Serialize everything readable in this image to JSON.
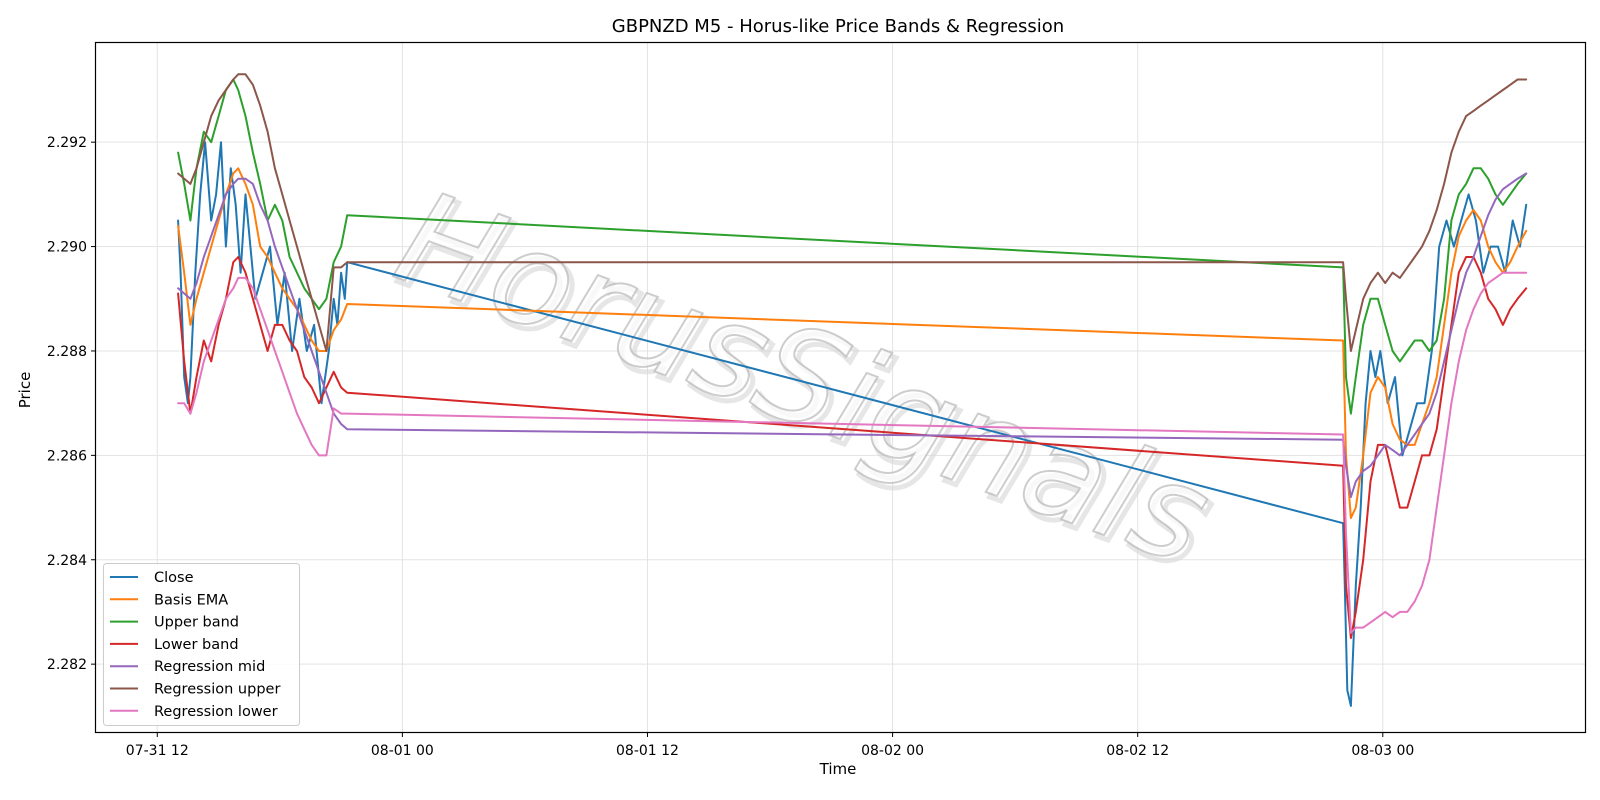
{
  "chart_data": {
    "type": "line",
    "title": "GBPNZD M5 - Horus-like Price Bands & Regression",
    "xlabel": "Time",
    "ylabel": "Price",
    "watermark": "HorusSignals",
    "ylim": [
      2.2807,
      2.2939
    ],
    "xlim": [
      -2.5,
      58.25
    ],
    "grid": true,
    "legend_position": "lower-left",
    "x_ticks": [
      {
        "value": 0,
        "label": "07-31 12"
      },
      {
        "value": 10,
        "label": "08-01 00"
      },
      {
        "value": 20,
        "label": "08-01 12"
      },
      {
        "value": 30,
        "label": "08-02 00"
      },
      {
        "value": 40,
        "label": "08-02 12"
      },
      {
        "value": 50,
        "label": "08-03 00"
      }
    ],
    "y_ticks": [
      {
        "value": 2.282,
        "label": "2.282"
      },
      {
        "value": 2.284,
        "label": "2.284"
      },
      {
        "value": 2.286,
        "label": "2.286"
      },
      {
        "value": 2.288,
        "label": "2.288"
      },
      {
        "value": 2.29,
        "label": "2.290"
      },
      {
        "value": 2.292,
        "label": "2.292"
      }
    ],
    "series": [
      {
        "name": "Close",
        "color": "#1f77b4",
        "x": [
          0.85,
          0.95,
          1.1,
          1.25,
          1.35,
          1.55,
          1.75,
          1.95,
          2.2,
          2.4,
          2.6,
          2.8,
          3.0,
          3.2,
          3.4,
          3.6,
          3.8,
          4.0,
          4.3,
          4.6,
          4.9,
          5.2,
          5.5,
          5.8,
          6.1,
          6.4,
          6.7,
          7.0,
          7.2,
          7.35,
          7.5,
          7.65,
          7.75,
          48.38,
          48.45,
          48.55,
          48.7,
          48.9,
          49.1,
          49.3,
          49.5,
          49.7,
          49.9,
          50.2,
          50.5,
          50.8,
          51.1,
          51.4,
          51.7,
          52.0,
          52.3,
          52.6,
          52.9,
          53.2,
          53.5,
          53.8,
          54.1,
          54.4,
          54.7,
          55.0,
          55.3,
          55.6,
          55.85
        ],
        "y": [
          2.2905,
          2.2895,
          2.2875,
          2.287,
          2.2875,
          2.2895,
          2.291,
          2.292,
          2.2905,
          2.291,
          2.292,
          2.29,
          2.2915,
          2.2908,
          2.2895,
          2.291,
          2.29,
          2.289,
          2.2895,
          2.29,
          2.2885,
          2.2895,
          2.288,
          2.289,
          2.288,
          2.2885,
          2.287,
          2.288,
          2.289,
          2.2885,
          2.2895,
          2.289,
          2.2897,
          2.2847,
          2.2835,
          2.2815,
          2.2812,
          2.2835,
          2.285,
          2.287,
          2.288,
          2.2875,
          2.288,
          2.287,
          2.2875,
          2.286,
          2.2865,
          2.287,
          2.287,
          2.288,
          2.29,
          2.2905,
          2.29,
          2.2905,
          2.291,
          2.2905,
          2.2895,
          2.29,
          2.29,
          2.2895,
          2.2905,
          2.29,
          2.2908
        ]
      },
      {
        "name": "Basis EMA",
        "color": "#ff7f0e",
        "x": [
          0.85,
          1.1,
          1.35,
          1.6,
          1.9,
          2.2,
          2.5,
          2.8,
          3.1,
          3.3,
          3.6,
          3.9,
          4.2,
          4.5,
          4.8,
          5.1,
          5.4,
          5.7,
          6.0,
          6.3,
          6.6,
          6.9,
          7.2,
          7.5,
          7.75,
          48.38,
          48.5,
          48.7,
          48.9,
          49.2,
          49.5,
          49.8,
          50.1,
          50.4,
          50.7,
          51.0,
          51.3,
          51.6,
          51.9,
          52.2,
          52.5,
          52.8,
          53.1,
          53.4,
          53.7,
          54.0,
          54.3,
          54.6,
          54.9,
          55.2,
          55.5,
          55.85
        ],
        "y": [
          2.2904,
          2.2895,
          2.2885,
          2.289,
          2.2895,
          2.29,
          2.2905,
          2.291,
          2.2914,
          2.2915,
          2.2912,
          2.2908,
          2.29,
          2.2898,
          2.2895,
          2.2892,
          2.289,
          2.2888,
          2.2885,
          2.2882,
          2.288,
          2.288,
          2.2884,
          2.2886,
          2.2889,
          2.2882,
          2.286,
          2.2848,
          2.285,
          2.286,
          2.2872,
          2.2875,
          2.2873,
          2.2866,
          2.2863,
          2.2862,
          2.2862,
          2.2866,
          2.287,
          2.2875,
          2.2885,
          2.2895,
          2.2902,
          2.2905,
          2.2907,
          2.2905,
          2.29,
          2.2897,
          2.2895,
          2.2897,
          2.29,
          2.2903
        ]
      },
      {
        "name": "Upper band",
        "color": "#2ca02c",
        "x": [
          0.85,
          1.1,
          1.35,
          1.6,
          1.9,
          2.2,
          2.5,
          2.8,
          3.1,
          3.3,
          3.6,
          3.9,
          4.2,
          4.5,
          4.8,
          5.1,
          5.4,
          5.7,
          6.0,
          6.3,
          6.6,
          6.9,
          7.2,
          7.5,
          7.75,
          48.38,
          48.5,
          48.7,
          48.9,
          49.2,
          49.5,
          49.8,
          50.1,
          50.4,
          50.7,
          51.0,
          51.3,
          51.6,
          51.9,
          52.2,
          52.5,
          52.8,
          53.1,
          53.4,
          53.7,
          54.0,
          54.3,
          54.6,
          54.9,
          55.2,
          55.5,
          55.85
        ],
        "y": [
          2.2918,
          2.2912,
          2.2905,
          2.2915,
          2.2922,
          2.292,
          2.2925,
          2.293,
          2.2932,
          2.293,
          2.2925,
          2.2918,
          2.2912,
          2.2905,
          2.2908,
          2.2905,
          2.2898,
          2.2895,
          2.2892,
          2.289,
          2.2888,
          2.289,
          2.2897,
          2.29,
          2.2906,
          2.2896,
          2.2875,
          2.2868,
          2.2875,
          2.2885,
          2.289,
          2.289,
          2.2885,
          2.288,
          2.2878,
          2.288,
          2.2882,
          2.2882,
          2.288,
          2.2882,
          2.289,
          2.2905,
          2.291,
          2.2912,
          2.2915,
          2.2915,
          2.2913,
          2.291,
          2.2908,
          2.291,
          2.2912,
          2.2914
        ]
      },
      {
        "name": "Lower band",
        "color": "#d62728",
        "x": [
          0.85,
          1.1,
          1.35,
          1.6,
          1.9,
          2.2,
          2.5,
          2.8,
          3.1,
          3.3,
          3.6,
          3.9,
          4.2,
          4.5,
          4.8,
          5.1,
          5.4,
          5.7,
          6.0,
          6.3,
          6.6,
          6.9,
          7.2,
          7.5,
          7.75,
          48.38,
          48.5,
          48.7,
          48.9,
          49.2,
          49.5,
          49.8,
          50.1,
          50.4,
          50.7,
          51.0,
          51.3,
          51.6,
          51.9,
          52.2,
          52.5,
          52.8,
          53.1,
          53.4,
          53.7,
          54.0,
          54.3,
          54.6,
          54.9,
          55.2,
          55.5,
          55.85
        ],
        "y": [
          2.2891,
          2.2878,
          2.2868,
          2.2875,
          2.2882,
          2.2878,
          2.2885,
          2.289,
          2.2897,
          2.2898,
          2.2895,
          2.289,
          2.2885,
          2.288,
          2.2885,
          2.2885,
          2.2882,
          2.288,
          2.2875,
          2.2873,
          2.287,
          2.2873,
          2.2876,
          2.2873,
          2.2872,
          2.2858,
          2.2835,
          2.2825,
          2.283,
          2.284,
          2.2855,
          2.2862,
          2.2862,
          2.2856,
          2.285,
          2.285,
          2.2855,
          2.286,
          2.286,
          2.2865,
          2.2875,
          2.2885,
          2.2895,
          2.2898,
          2.2898,
          2.2895,
          2.289,
          2.2888,
          2.2885,
          2.2888,
          2.289,
          2.2892
        ]
      },
      {
        "name": "Regression mid",
        "color": "#9467bd",
        "x": [
          0.85,
          1.1,
          1.35,
          1.6,
          1.9,
          2.2,
          2.5,
          2.8,
          3.1,
          3.3,
          3.6,
          3.9,
          4.2,
          4.5,
          4.8,
          5.1,
          5.4,
          5.7,
          6.0,
          6.3,
          6.6,
          6.9,
          7.2,
          7.5,
          7.75,
          48.38,
          48.5,
          48.7,
          48.9,
          49.2,
          49.5,
          49.8,
          50.1,
          50.4,
          50.7,
          51.0,
          51.3,
          51.6,
          51.9,
          52.2,
          52.5,
          52.8,
          53.1,
          53.4,
          53.7,
          54.0,
          54.3,
          54.6,
          54.9,
          55.2,
          55.5,
          55.85
        ],
        "y": [
          2.2892,
          2.2891,
          2.289,
          2.2893,
          2.2898,
          2.2902,
          2.2906,
          2.291,
          2.2912,
          2.2913,
          2.2913,
          2.2912,
          2.2908,
          2.2905,
          2.29,
          2.2896,
          2.2892,
          2.2888,
          2.2884,
          2.288,
          2.2876,
          2.2872,
          2.2868,
          2.2866,
          2.2865,
          2.2863,
          2.2858,
          2.2852,
          2.2855,
          2.2857,
          2.2858,
          2.286,
          2.2862,
          2.2861,
          2.286,
          2.2862,
          2.2864,
          2.2866,
          2.2868,
          2.2872,
          2.2878,
          2.2884,
          2.289,
          2.2895,
          2.2898,
          2.2902,
          2.2906,
          2.2909,
          2.2911,
          2.2912,
          2.2913,
          2.2914
        ]
      },
      {
        "name": "Regression upper",
        "color": "#8c564b",
        "x": [
          0.85,
          1.1,
          1.35,
          1.6,
          1.9,
          2.2,
          2.5,
          2.8,
          3.1,
          3.3,
          3.6,
          3.9,
          4.2,
          4.5,
          4.8,
          5.1,
          5.4,
          5.7,
          6.0,
          6.3,
          6.6,
          6.9,
          7.2,
          7.5,
          7.75,
          48.38,
          48.5,
          48.7,
          48.9,
          49.2,
          49.5,
          49.8,
          50.1,
          50.4,
          50.7,
          51.0,
          51.3,
          51.6,
          51.9,
          52.2,
          52.5,
          52.8,
          53.1,
          53.4,
          53.7,
          54.0,
          54.3,
          54.6,
          54.9,
          55.2,
          55.5,
          55.85
        ],
        "y": [
          2.2914,
          2.2913,
          2.2912,
          2.2915,
          2.292,
          2.2925,
          2.2928,
          2.293,
          2.2932,
          2.2933,
          2.2933,
          2.2931,
          2.2927,
          2.2922,
          2.2915,
          2.291,
          2.2905,
          2.29,
          2.2895,
          2.289,
          2.2885,
          2.288,
          2.2896,
          2.2896,
          2.2897,
          2.2897,
          2.289,
          2.288,
          2.2884,
          2.289,
          2.2893,
          2.2895,
          2.2893,
          2.2895,
          2.2894,
          2.2896,
          2.2898,
          2.29,
          2.2903,
          2.2907,
          2.2912,
          2.2918,
          2.2922,
          2.2925,
          2.2926,
          2.2927,
          2.2928,
          2.2929,
          2.293,
          2.2931,
          2.2932,
          2.2932
        ]
      },
      {
        "name": "Regression lower",
        "color": "#e377c2",
        "x": [
          0.85,
          1.1,
          1.35,
          1.6,
          1.9,
          2.2,
          2.5,
          2.8,
          3.1,
          3.3,
          3.6,
          3.9,
          4.2,
          4.5,
          4.8,
          5.1,
          5.4,
          5.7,
          6.0,
          6.3,
          6.6,
          6.9,
          7.2,
          7.5,
          7.75,
          48.38,
          48.5,
          48.7,
          48.9,
          49.2,
          49.5,
          49.8,
          50.1,
          50.4,
          50.7,
          51.0,
          51.3,
          51.6,
          51.9,
          52.2,
          52.5,
          52.8,
          53.1,
          53.4,
          53.7,
          54.0,
          54.3,
          54.6,
          54.9,
          55.2,
          55.5,
          55.85
        ],
        "y": [
          2.287,
          2.287,
          2.2868,
          2.2872,
          2.2878,
          2.2882,
          2.2886,
          2.289,
          2.2892,
          2.2894,
          2.2894,
          2.2892,
          2.2888,
          2.2884,
          2.288,
          2.2876,
          2.2872,
          2.2868,
          2.2865,
          2.2862,
          2.286,
          2.286,
          2.2869,
          2.2868,
          2.2868,
          2.2864,
          2.2845,
          2.2826,
          2.2827,
          2.2827,
          2.2828,
          2.2829,
          2.283,
          2.2829,
          2.283,
          2.283,
          2.2832,
          2.2835,
          2.284,
          2.285,
          2.286,
          2.287,
          2.2878,
          2.2884,
          2.2888,
          2.2891,
          2.2893,
          2.2894,
          2.2895,
          2.2895,
          2.2895,
          2.2895
        ]
      }
    ]
  }
}
